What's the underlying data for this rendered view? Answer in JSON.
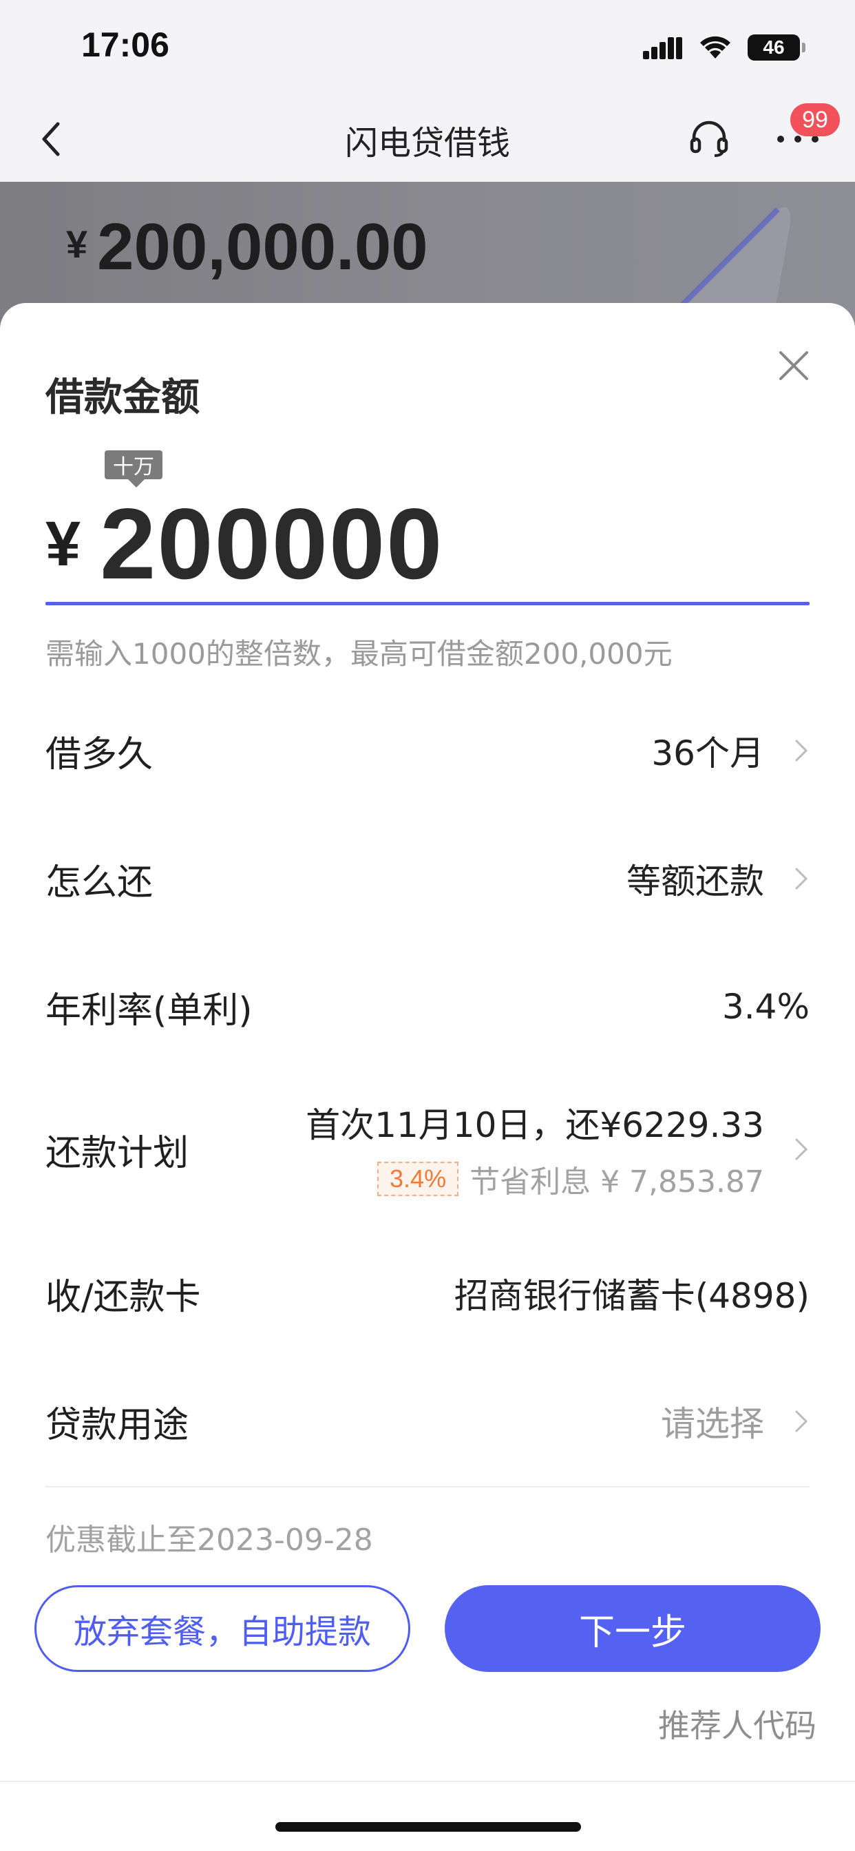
{
  "status_bar": {
    "time": "17:06",
    "battery": "46",
    "icons": [
      "signal-icon",
      "wifi-icon",
      "battery-icon"
    ]
  },
  "nav": {
    "title": "闪电贷借钱",
    "badge": "99",
    "icons": [
      "back-icon",
      "headset-icon",
      "more-icon"
    ]
  },
  "banner": {
    "currency": "¥",
    "amount": "200,000.00"
  },
  "sheet": {
    "title": "借款金额",
    "unit_tip": "十万",
    "currency": "¥",
    "amount": "200000",
    "hint": "需输入1000的整倍数，最高可借金额200,000元",
    "rows": {
      "term": {
        "label": "借多久",
        "value": "36个月"
      },
      "repay_method": {
        "label": "怎么还",
        "value": "等额还款"
      },
      "rate": {
        "label": "年利率(单利)",
        "value": "3.4%"
      },
      "plan": {
        "label": "还款计划",
        "first_line": "首次11月10日，还¥6229.33",
        "rate_tag": "3.4%",
        "save_text": "节省利息 ¥ 7,853.87"
      },
      "card": {
        "label": "收/还款卡",
        "value": "招商银行储蓄卡(4898)"
      },
      "purpose": {
        "label": "贷款用途",
        "value": "请选择"
      }
    },
    "promo": "优惠截止至2023-09-28",
    "btn_abandon": "放弃套餐，自助提款",
    "btn_next": "下一步",
    "referrer": "推荐人代码"
  },
  "colors": {
    "accent": "#5561f0",
    "badge": "#f0515a",
    "tag_orange": "#ef7a3a"
  }
}
